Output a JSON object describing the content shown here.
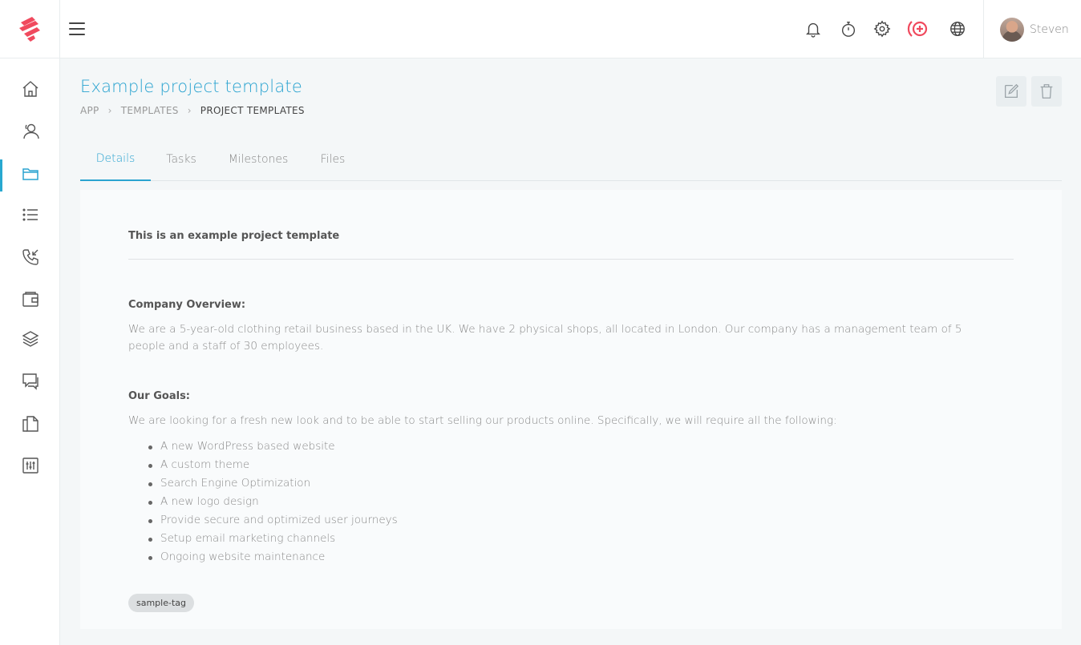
{
  "header": {
    "user_name": "Steven",
    "icons": [
      "bell-icon",
      "stopwatch-icon",
      "gear-icon",
      "add-circle-icon",
      "globe-icon"
    ],
    "accent_color": "#f04a5e"
  },
  "sidebar": {
    "items": [
      "home-icon",
      "contacts-icon",
      "folder-icon",
      "list-icon",
      "phone-icon",
      "wallet-icon",
      "layers-icon",
      "chat-icon",
      "documents-icon",
      "sliders-icon"
    ],
    "active_index": 2
  },
  "page": {
    "title": "Example project template",
    "breadcrumb": [
      "APP",
      "TEMPLATES",
      "PROJECT TEMPLATES"
    ]
  },
  "tabs": [
    "Details",
    "Tasks",
    "Milestones",
    "Files"
  ],
  "details": {
    "intro": "This is an example project template",
    "overview_heading": "Company Overview:",
    "overview_text": "We are a 5-year-old clothing retail business based in the UK. We have  2 physical shops, all located in London. Our company has a management team of 5 people and a staff of 30 employees.",
    "goals_heading": "Our Goals:",
    "goals_text": "We are looking for a fresh new look and to be able to start selling our products online. Specifically, we will require all the following:",
    "goals": [
      "A new WordPress based website",
      "A custom theme",
      "Search Engine Optimization",
      "A new logo design",
      "Provide secure and optimized user journeys",
      "Setup email marketing channels",
      "Ongoing website maintenance"
    ],
    "tag": "sample-tag"
  },
  "colors": {
    "primary": "#2aa3d0",
    "brand": "#f04a5e"
  }
}
